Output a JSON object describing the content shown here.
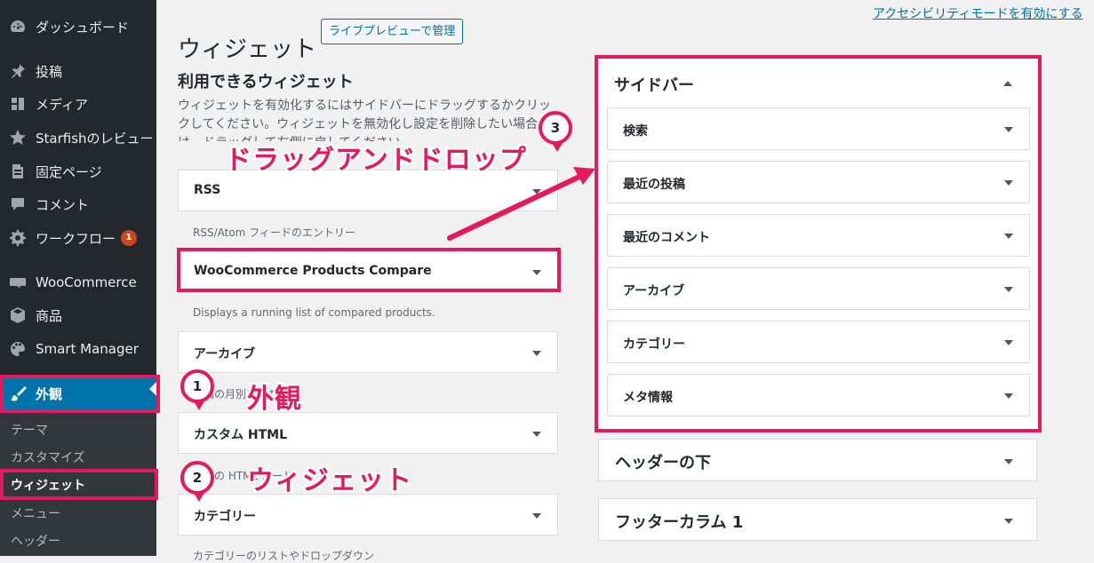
{
  "admin_menu": {
    "items": [
      {
        "label": "ダッシュボード",
        "icon": "dashboard-icon"
      },
      {
        "label": "投稿",
        "icon": "pin-icon"
      },
      {
        "label": "メディア",
        "icon": "media-icon"
      },
      {
        "label": "Starfishのレビュー",
        "icon": "star-icon"
      },
      {
        "label": "固定ページ",
        "icon": "page-icon"
      },
      {
        "label": "コメント",
        "icon": "comment-icon"
      },
      {
        "label": "ワークフロー",
        "icon": "gear-icon",
        "badge": "1"
      },
      {
        "label": "WooCommerce",
        "icon": "woocommerce-icon"
      },
      {
        "label": "商品",
        "icon": "box-icon"
      },
      {
        "label": "Smart Manager",
        "icon": "palette-icon"
      },
      {
        "label": "外観",
        "icon": "paintbrush-icon"
      }
    ],
    "submenu": [
      "テーマ",
      "カスタマイズ",
      "ウィジェット",
      "メニュー",
      "ヘッダー"
    ]
  },
  "header": {
    "title": "ウィジェット",
    "live_preview_button": "ライブプレビューで管理",
    "accessibility_link": "アクセシビリティモードを有効にする"
  },
  "available": {
    "title": "利用できるウィジェット",
    "description": "ウィジェットを有効化するにはサイドバーにドラッグするかクリックしてください。ウィジェットを無効化し設定を削除したい場合は、ドラッグして左側に戻してください。",
    "widgets": [
      {
        "title": "RSS",
        "desc": "RSS/Atom フィードのエントリー"
      },
      {
        "title": "WooCommerce Products Compare",
        "desc": "Displays a running list of compared products."
      },
      {
        "title": "アーカイブ",
        "desc": "投稿の月別アーカイブ"
      },
      {
        "title": "カスタム HTML",
        "desc": "任意の HTML コード"
      },
      {
        "title": "カテゴリー",
        "desc": "カテゴリーのリストやドロップダウン"
      }
    ]
  },
  "sidebar_area": {
    "title": "サイドバー",
    "widgets": [
      "検索",
      "最近の投稿",
      "最近のコメント",
      "アーカイブ",
      "カテゴリー",
      "メタ情報"
    ]
  },
  "other_areas": [
    "ヘッダーの下",
    "フッターカラム 1"
  ],
  "annotations": {
    "marker1": "1",
    "marker2": "2",
    "marker3": "3",
    "label_appearance": "外観",
    "label_widget": "ウィジェット",
    "label_dragdrop": "ドラッグアンドドロップ"
  },
  "colors": {
    "highlight": "#e6195f",
    "accent": "#0073aa",
    "admin_bg": "#23282d"
  }
}
